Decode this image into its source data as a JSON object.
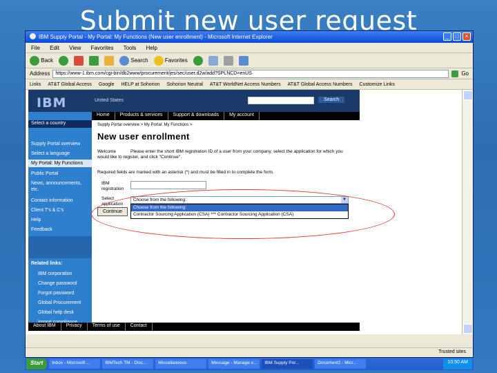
{
  "slide": {
    "title": "Submit new user request"
  },
  "browser": {
    "title": "IBM Supply Portal - My Portal: My Functions (New user enrollment) - Microsoft Internet Explorer",
    "menu": [
      "File",
      "Edit",
      "View",
      "Favorites",
      "Tools",
      "Help"
    ],
    "toolbar": {
      "back": "Back",
      "search": "Search",
      "favorites": "Favorites"
    },
    "address_label": "Address",
    "address": "https://www-1.ibm.com/cgi-bin/db2www/procurement/jes/sec/user.d2w/add?SPLNCD=enUS",
    "go": "Go",
    "links_label": "Links",
    "links": [
      "AT&T Global Access",
      "Google",
      "HELP at Sohorion",
      "Sohorion Neutral",
      "AT&T WorldNet Access Numbers",
      "AT&T Global Access Numbers",
      "Customize Links"
    ],
    "status_zone": "Trusted sites"
  },
  "page": {
    "logo": "IBM",
    "country": "United States",
    "search_btn": "Search",
    "nav": [
      "Home",
      "Products & services",
      "Support & downloads",
      "My account"
    ],
    "select_country": "Select a country",
    "left_nav": [
      "Supply Portal overview",
      "Select a language",
      "My Portal: My Functions",
      "Public Portal",
      "News, announcements, etc.",
      "Contact information",
      "Client T's & C's",
      "Help",
      "Feedback"
    ],
    "related_title": "Related links:",
    "related": [
      "IBM corporation",
      "Change password",
      "Forgot password",
      "Global Procurement",
      "Global help desk",
      "Import compliance guidelines"
    ],
    "breadcrumb": "Supply Portal overview  >  My Portal: My Functions  >",
    "title": "New user enrollment",
    "welcome_prefix": "Welcome",
    "welcome_text": "Please enter the short IBM registration ID of a user from your company, select the application for which you would like to register, and click \"Continue\".",
    "required": "Required fields are marked with an asterisk (*) and must be filled in to complete the form.",
    "id_label": "IBM registration",
    "app_label": "Select application",
    "select_value": "Choose from the following:",
    "options": [
      "Choose from the following:",
      "Contractor Sourcing Application (CSA) *** Contractor Sourcing Application (CSA)"
    ],
    "continue": "Continue",
    "footer": [
      "About IBM",
      "Privacy",
      "Terms of use",
      "Contact"
    ]
  },
  "taskbar": {
    "start": "Start",
    "tasks": [
      "Inbox - Microsoft ...",
      "IBMTech TM - Disc...",
      "Miscellaneous",
      "Message - Manage o...",
      "IBM Supply Por...",
      "Document2 - Micr..."
    ],
    "clock": "10:50 AM"
  }
}
